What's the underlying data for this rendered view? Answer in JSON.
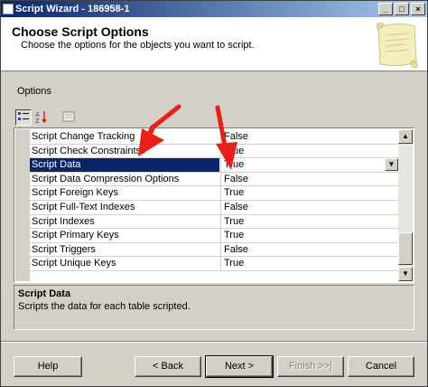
{
  "window": {
    "title": "Script Wizard - 186958-1",
    "controls": {
      "minimize": "_",
      "maximize": "□",
      "close": "×"
    }
  },
  "header": {
    "title": "Choose Script Options",
    "subtitle": "Choose the options for the objects you want to script."
  },
  "options_label": "Options",
  "toolbar": {
    "categorized_icon": "categorized-icon",
    "alphabetical_icon": "alphabetical-icon",
    "property_pages_icon": "property-pages-icon"
  },
  "grid": {
    "rows": [
      {
        "name": "Script Change Tracking",
        "value": "False"
      },
      {
        "name": "Script Check Constraints",
        "value": "True"
      },
      {
        "name": "Script Data",
        "value": "True",
        "selected": true
      },
      {
        "name": "Script Data Compression Options",
        "value": "False"
      },
      {
        "name": "Script Foreign Keys",
        "value": "True"
      },
      {
        "name": "Script Full-Text Indexes",
        "value": "False"
      },
      {
        "name": "Script Indexes",
        "value": "True"
      },
      {
        "name": "Script Primary Keys",
        "value": "True"
      },
      {
        "name": "Script Triggers",
        "value": "False"
      },
      {
        "name": "Script Unique Keys",
        "value": "True"
      }
    ]
  },
  "description": {
    "title": "Script Data",
    "text": "Scripts the data for each table scripted."
  },
  "buttons": {
    "help": "Help",
    "back": "< Back",
    "next": "Next >",
    "finish": "Finish >>|",
    "cancel": "Cancel"
  },
  "colors": {
    "selection": "#0a246a",
    "annotation_arrow": "#e8201c",
    "dialog_bg": "#d4d0c8"
  }
}
